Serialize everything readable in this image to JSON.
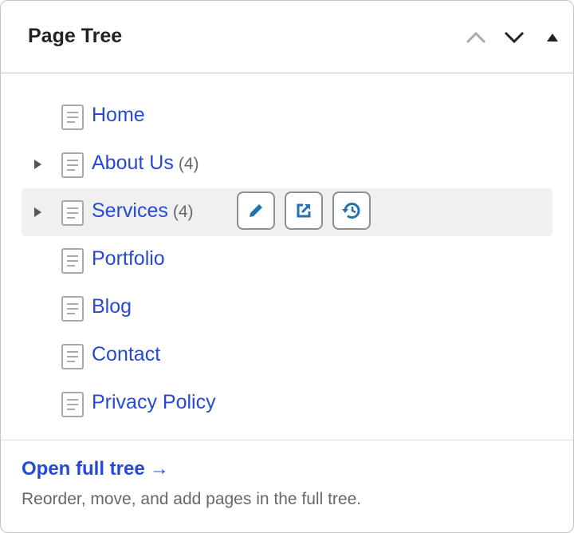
{
  "header": {
    "title": "Page Tree",
    "controls": [
      "chevron-up-icon",
      "chevron-down-icon",
      "triangle-up-icon"
    ]
  },
  "tree": {
    "items": [
      {
        "label": "Home",
        "count": "",
        "expandable": false
      },
      {
        "label": "About Us",
        "count": "(4)",
        "expandable": true
      },
      {
        "label": "Services",
        "count": "(4)",
        "expandable": true,
        "highlighted": true,
        "actions": [
          "pencil-icon",
          "external-link-icon",
          "history-icon"
        ]
      },
      {
        "label": "Portfolio",
        "count": "",
        "expandable": false
      },
      {
        "label": "Blog",
        "count": "",
        "expandable": false
      },
      {
        "label": "Contact",
        "count": "",
        "expandable": false
      },
      {
        "label": "Privacy Policy",
        "count": "",
        "expandable": false
      }
    ]
  },
  "footer": {
    "open_link": "Open full tree",
    "open_arrow": "→",
    "hint": "Reorder, move, and add pages in the full tree."
  },
  "colors": {
    "link": "#2649d8",
    "highlight": "#f0f0f1",
    "action_icon": "#2271b1",
    "muted": "#646970"
  }
}
